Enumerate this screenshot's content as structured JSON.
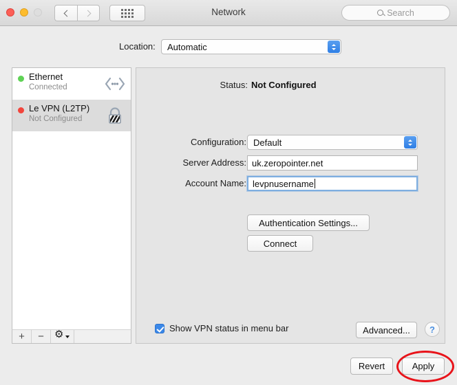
{
  "window": {
    "title": "Network",
    "traffic_lights": [
      "close",
      "minimize",
      "zoom"
    ],
    "nav_back_icon": "chevron-left-icon",
    "nav_forward_icon": "chevron-right-icon",
    "show_all_icon": "grid-dots-icon"
  },
  "search": {
    "placeholder": "Search",
    "icon": "search-icon"
  },
  "location": {
    "label": "Location:",
    "value": "Automatic",
    "options": [
      "Automatic"
    ]
  },
  "sidebar": {
    "services": [
      {
        "name": "Ethernet",
        "status": "Connected",
        "status_color": "#5fd255",
        "icon": "ethernet-icon",
        "selected": false
      },
      {
        "name": "Le VPN (L2TP)",
        "status": "Not Configured",
        "status_color": "#f2453c",
        "icon": "vpn-lock-icon",
        "selected": true
      }
    ],
    "footer": {
      "add_label": "+",
      "remove_label": "−",
      "action_icon": "gear-icon"
    }
  },
  "panel": {
    "status_label": "Status:",
    "status_value": "Not Configured",
    "configuration": {
      "label": "Configuration:",
      "value": "Default",
      "options": [
        "Default"
      ]
    },
    "server_address": {
      "label": "Server Address:",
      "value": "uk.zeropointer.net",
      "placeholder": ""
    },
    "account_name": {
      "label": "Account Name:",
      "value": "levpnusername",
      "placeholder": "",
      "focused": true
    },
    "auth_settings_label": "Authentication Settings...",
    "connect_label": "Connect",
    "show_vpn_status": {
      "label": "Show VPN status in menu bar",
      "checked": true
    },
    "advanced_label": "Advanced...",
    "help_label": "?"
  },
  "footer": {
    "revert_label": "Revert",
    "apply_label": "Apply"
  },
  "annotation": {
    "type": "ellipse",
    "color": "#e8131a",
    "target": "apply-button"
  },
  "colors": {
    "accent_blue": "#3b88e8",
    "panel_bg": "#e5e5e5",
    "window_bg": "#ececec",
    "selection": "#dcdcdc",
    "annotation_red": "#e8131a"
  }
}
